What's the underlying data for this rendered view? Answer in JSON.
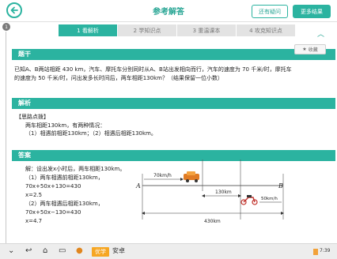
{
  "header": {
    "title": "参考解答",
    "ask_question": "还有疑问",
    "more_results": "更多结果",
    "side_index": "1"
  },
  "steps": [
    {
      "label": "1 看解析"
    },
    {
      "label": "2 学知识点"
    },
    {
      "label": "3 重温课本"
    },
    {
      "label": "4 攻克知识点"
    }
  ],
  "question": {
    "heading": "题干",
    "favorite": "收藏",
    "line1": "已知A、B两站相距 430 km，汽车、摩托车分别同时从A、B站出发相向而行，汽车的速度为 70 千米/时，摩托车",
    "line2": "的速度为 50 千米/时，问出发多长时间后，两车相距130km？（结果保留一位小数）"
  },
  "analysis": {
    "heading": "解析",
    "tip": "【思路点拨】",
    "line1": "两车相距130km，有两种情况：",
    "line2": "（1）相遇前相距130km；（2）相遇后相距130km。"
  },
  "answer": {
    "heading": "答案",
    "lines": [
      "解：设出发x小时后，两车相距130km。",
      "（1）两车相遇前相距130km，",
      "70x+50x+130=430",
      "x=2.5",
      "（2）两车相遇后相距130km，",
      "70x+50x−130=430",
      "x=4.7"
    ]
  },
  "diagram": {
    "point_a": "A",
    "point_b": "B",
    "car_speed": "70km/h",
    "moto_speed": "50km/h",
    "gap": "130km",
    "total": "430km"
  },
  "bottom": {
    "tag_yx": "优学",
    "tag_az": "安卓",
    "time": "7:39"
  },
  "colors": {
    "accent": "#2bb3a0",
    "orange": "#f6a623"
  }
}
